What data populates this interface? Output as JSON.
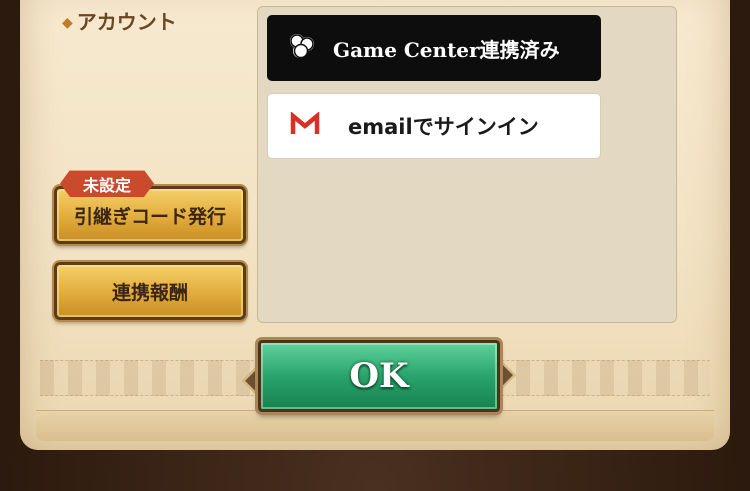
{
  "section": {
    "marker": "◆",
    "title": "アカウント"
  },
  "account_links": {
    "game_center_label": "Game Center連携済み",
    "email_label": "emailでサインイン"
  },
  "left_buttons": {
    "unset_badge": "未設定",
    "transfer_code_label": "引継ぎコード発行",
    "link_reward_label": "連携報酬"
  },
  "ok_label": "OK",
  "colors": {
    "parchment": "#f3e3c4",
    "gold_button": "#e6b243",
    "ok_green": "#2aa46c",
    "badge_red": "#c94a2c",
    "gmail_red": "#d93025"
  },
  "icons": {
    "game_center": "game-center-icon",
    "gmail": "gmail-m-icon"
  }
}
